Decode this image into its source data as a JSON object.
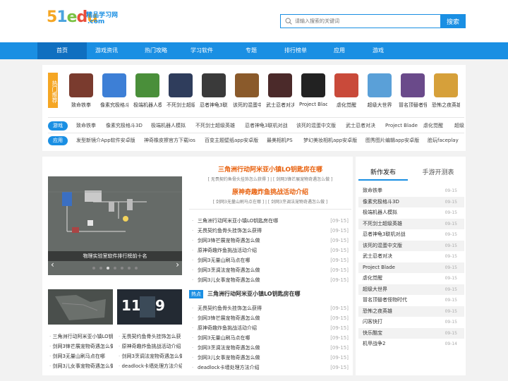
{
  "logo": {
    "digits": [
      "5",
      "1",
      "e",
      "d",
      "u"
    ],
    "name": "精品学习网",
    "domain": ".com"
  },
  "search": {
    "placeholder": "请输入搜索的关键词",
    "button": "搜索"
  },
  "nav": [
    "首页",
    "游戏资讯",
    "热门攻略",
    "学习软件",
    "专题",
    "排行榜单",
    "应用",
    "游戏"
  ],
  "hot": {
    "tag": "热门推荐",
    "games": [
      {
        "name": "致命铁拳",
        "color": "#7a3b2e"
      },
      {
        "name": "像素究极格斗3D",
        "color": "#3d7fd6"
      },
      {
        "name": "极端机器人模拟",
        "color": "#4a8f3a"
      },
      {
        "name": "不死剑士超级英雄",
        "color": "#2f3d5c"
      },
      {
        "name": "忍者神龟3联机对战",
        "color": "#3a3a3a"
      },
      {
        "name": "该死的混蛋中文版",
        "color": "#8a5a2b"
      },
      {
        "name": "武士忍者对决",
        "color": "#4b2a2a"
      },
      {
        "name": "Project Blade",
        "color": "#222222"
      },
      {
        "name": "虐化觉醒",
        "color": "#c94a3a"
      },
      {
        "name": "超级大世界",
        "color": "#5aa0d8"
      },
      {
        "name": "冒名顶替者怪物时代",
        "color": "#6a4a8a"
      },
      {
        "name": "恐怖之夜英雄",
        "color": "#d6a03a"
      }
    ]
  },
  "tagrows": [
    {
      "label": "游戏",
      "items": [
        "致命铁拳",
        "像素究极格斗3D",
        "极端机器人模拟",
        "不死剑士超级英雄",
        "忍者神龟3联机对战",
        "该死的混蛋中文版",
        "武士忍者对决",
        "Project Blade",
        "虐化觉醒",
        "超级"
      ]
    },
    {
      "label": "应用",
      "items": [
        "发型新镜介App软件安卓版",
        "神奇橡皮擦官方下载ios",
        "百变主题壁纸app安卓版",
        "最美相机PS",
        "梦幻美妆相机app安卓版",
        "图秀图片编辑app安卓版",
        "脸玩faceplay"
      ]
    }
  ],
  "slider": {
    "caption": "物理实验室软件排行榜前十名",
    "prev": "‹",
    "next": "›"
  },
  "bottom_left": {
    "col1": [
      "三角洲行动阿米亚小镇LO钥",
      "剑网3锋芒展宠物奇遇怎么做",
      "剑网3无量山刷马点在哪",
      "剑网3儿女事宠物奇遇怎么做"
    ],
    "col2": [
      "无畏契约鱼骨头挂饰怎么获",
      "原神奇趣炸鱼挑战活动介绍",
      "剑网3烹调法宠物奇遇怎么做",
      "deadlock卡墙处理方法介绍"
    ]
  },
  "center": {
    "headline1": "三角洲行动阿米亚小镇LO钥匙房在哪",
    "sub1": "[ 无畏契约鱼骨头挂饰怎么获得 ] | [ 剑网3锋芒展宠物奇遇怎么做 ]",
    "headline2": "原神奇趣炸鱼挑战活动介绍",
    "sub2": "[ 剑网3无量山刷马点在哪 ] | [ 剑网3烹调法宠物奇遇怎么做 ]",
    "list1": [
      {
        "t": "三角洲行动阿米亚小镇LO钥匙房在哪",
        "d": "[09-15]"
      },
      {
        "t": "无畏契约鱼骨头挂饰怎么获得",
        "d": "[09-15]"
      },
      {
        "t": "剑网3锋芒展宠物奇遇怎么做",
        "d": "[09-15]"
      },
      {
        "t": "原神奇趣炸鱼挑战活动介绍",
        "d": "[09-15]"
      },
      {
        "t": "剑网3无量山刷马点在哪",
        "d": "[09-15]"
      },
      {
        "t": "剑网3烹调法宠物奇遇怎么做",
        "d": "[09-15]"
      },
      {
        "t": "剑网3儿女事宠物奇遇怎么做",
        "d": "[09-15]"
      }
    ],
    "hot_badge": "热点",
    "hot_title": "三角洲行动阿米亚小镇LO钥匙房在哪",
    "list2": [
      {
        "t": "无畏契约鱼骨头挂饰怎么获得",
        "d": "[09-15]"
      },
      {
        "t": "剑网3锋芒展宠物奇遇怎么做",
        "d": "[09-15]"
      },
      {
        "t": "原神奇趣炸鱼挑战活动介绍",
        "d": "[09-15]"
      },
      {
        "t": "剑网3无量山刷马点在哪",
        "d": "[09-15]"
      },
      {
        "t": "剑网3烹调法宠物奇遇怎么做",
        "d": "[09-15]"
      },
      {
        "t": "剑网3儿女事宠物奇遇怎么做",
        "d": "[09-15]"
      },
      {
        "t": "deadlock卡墙处理方法介绍",
        "d": "[09-15]"
      }
    ]
  },
  "right": {
    "tab_on": "新作发布",
    "tab_off": "手游开测表",
    "items": [
      {
        "t": "致命铁拳",
        "d": "09-15"
      },
      {
        "t": "像素究极格斗3D",
        "d": "09-15"
      },
      {
        "t": "极端机器人模拟",
        "d": "09-15"
      },
      {
        "t": "不死剑士超级英雄",
        "d": "09-15"
      },
      {
        "t": "忍者神龟3联机对战",
        "d": "09-15"
      },
      {
        "t": "该死的混蛋中文版",
        "d": "09-15"
      },
      {
        "t": "武士忍者对决",
        "d": "09-15"
      },
      {
        "t": "Project Blade",
        "d": "09-15"
      },
      {
        "t": "虐化觉醒",
        "d": "09-15"
      },
      {
        "t": "超级大世界",
        "d": "09-15"
      },
      {
        "t": "冒名顶替者怪物时代",
        "d": "09-15"
      },
      {
        "t": "恐怖之夜英雄",
        "d": "09-15"
      },
      {
        "t": "闪客快打",
        "d": "09-15"
      },
      {
        "t": "快乐酷宝",
        "d": "09-15"
      },
      {
        "t": "机甲战争2",
        "d": "09-14"
      }
    ]
  }
}
